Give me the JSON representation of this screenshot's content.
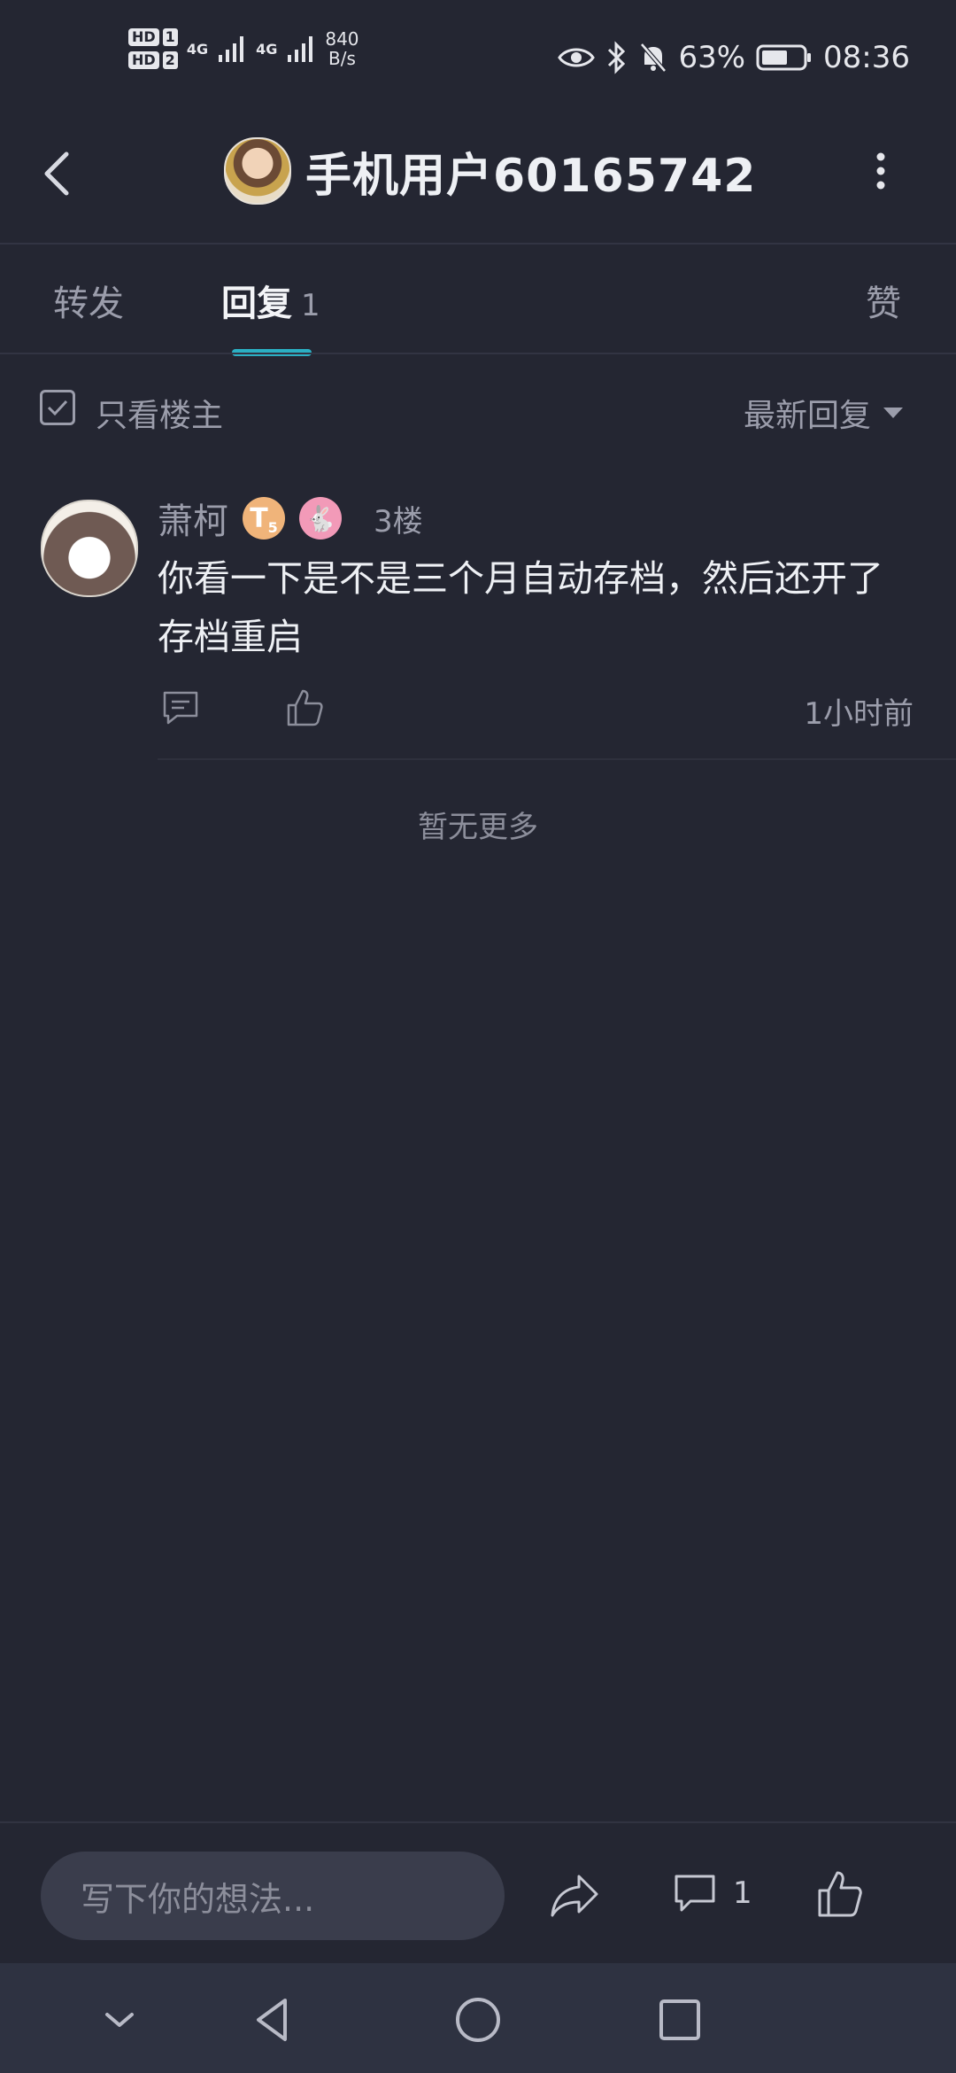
{
  "status_bar": {
    "sim1": "HD",
    "sim1_num": "1",
    "sim2": "HD",
    "sim2_num": "2",
    "network1": "4G",
    "network2": "4G",
    "speed_value": "840",
    "speed_unit": "B/s",
    "battery": "63%",
    "time": "08:36"
  },
  "header": {
    "title": "手机用户60165742"
  },
  "tabs": [
    {
      "label": "转发"
    },
    {
      "label": "回复",
      "count": "1"
    },
    {
      "label": "赞"
    }
  ],
  "filter": {
    "only_op_label": "只看楼主",
    "sort_label": "最新回复"
  },
  "post": {
    "username": "萧柯",
    "level_badge": "T",
    "level_num": "5",
    "floor": "3楼",
    "content": "你看一下是不是三个月自动存档，然后还开了存档重启",
    "time": "1小时前"
  },
  "no_more": "暂无更多",
  "bottom": {
    "input_placeholder": "写下你的想法...",
    "comment_count": "1"
  },
  "colors": {
    "background": "#242632",
    "accent": "#2bb0c4"
  }
}
